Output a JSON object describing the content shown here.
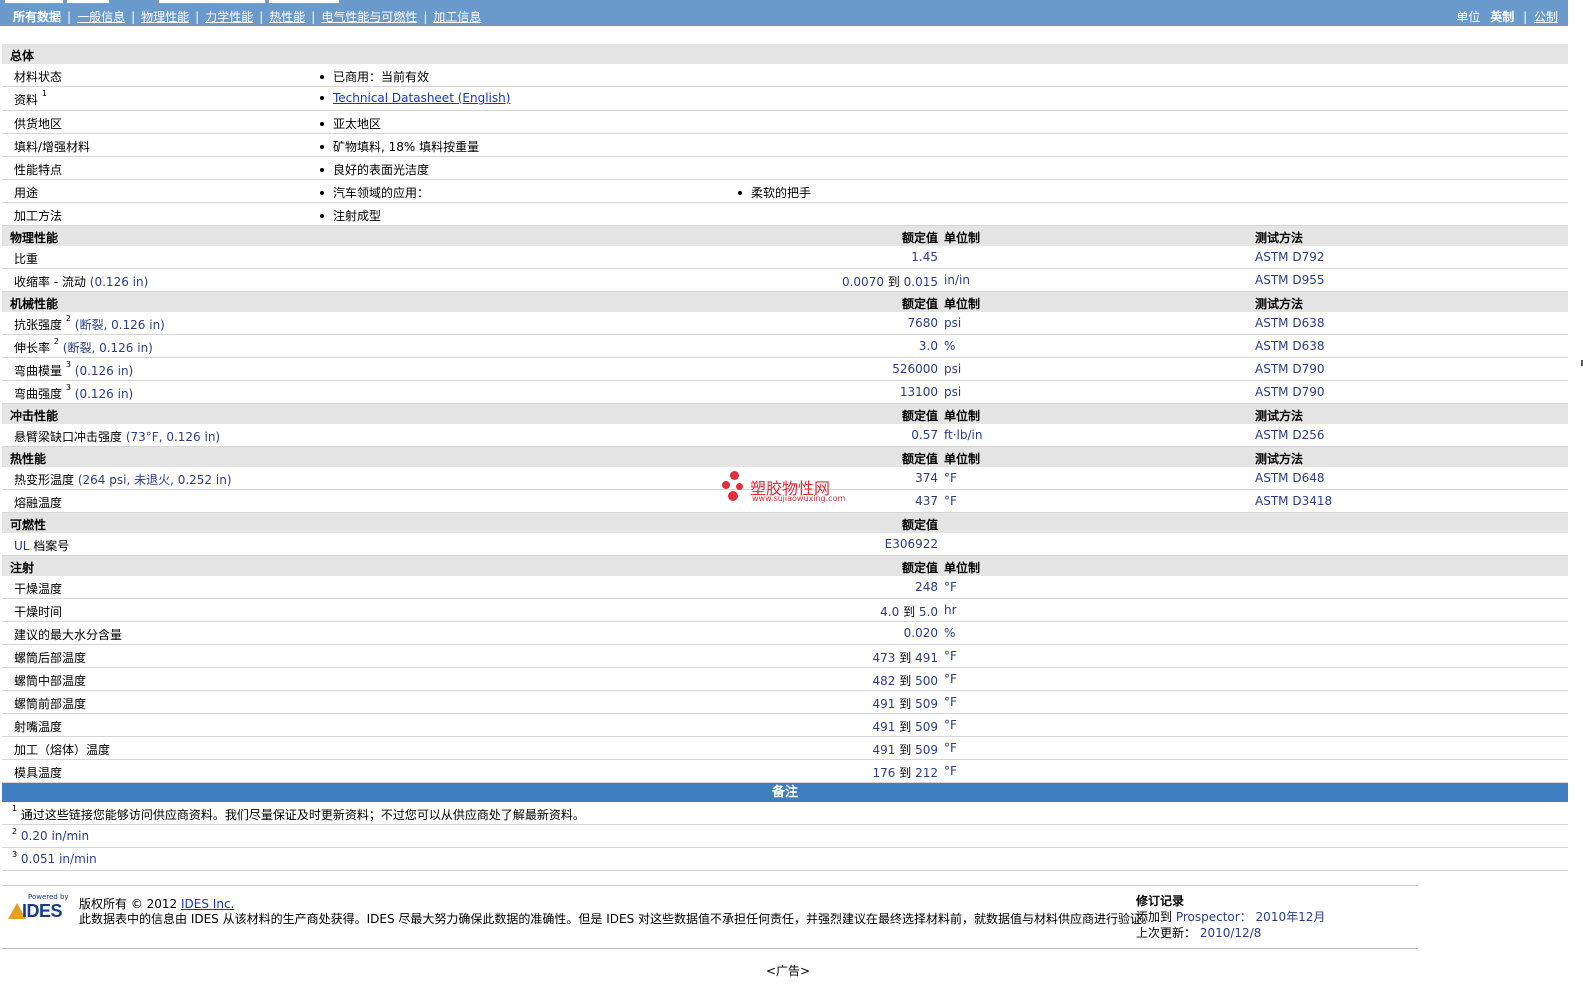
{
  "nav": {
    "items": [
      "所有数据",
      "一般信息",
      "物理性能",
      "力学性能",
      "热性能",
      "电气性能与可燃性",
      "加工信息"
    ],
    "unit_label": "单位",
    "unit_imperial": "英制",
    "unit_metric": "公制"
  },
  "general": {
    "title": "总体",
    "rows": [
      {
        "label": "材料状态",
        "items": [
          "已商用：当前有效"
        ]
      },
      {
        "label": "资料",
        "sup": "1",
        "items": [
          "Technical Datasheet (English)"
        ],
        "link": true
      },
      {
        "label": "供货地区",
        "items": [
          "亚太地区"
        ]
      },
      {
        "label": "填料/增强材料",
        "items": [
          "矿物填料, 18% 填料按重量"
        ]
      },
      {
        "label": "性能特点",
        "items": [
          "良好的表面光洁度"
        ]
      },
      {
        "label": "用途",
        "items": [
          "汽车领域的应用：",
          "柔软的把手"
        ]
      },
      {
        "label": "加工方法",
        "items": [
          "注射成型"
        ]
      }
    ]
  },
  "col_headers": {
    "value": "额定值",
    "unit": "单位制",
    "test": "测试方法"
  },
  "physical": {
    "title": "物理性能",
    "rows": [
      {
        "label": "比重",
        "extra": "",
        "value": "1.45",
        "unit": "",
        "test": "ASTM D792"
      },
      {
        "label": "收缩率 - 流动",
        "extra": "(0.126 in)",
        "v1": "0.0070",
        "v2": "0.015",
        "unit": "in/in",
        "test": "ASTM D955"
      }
    ]
  },
  "mechanical": {
    "title": "机械性能",
    "rows": [
      {
        "label": "抗张强度",
        "sup": "2",
        "extra": "(断裂, 0.126 in)",
        "value": "7680",
        "unit": "psi",
        "test": "ASTM D638"
      },
      {
        "label": "伸长率",
        "sup": "2",
        "extra": "(断裂, 0.126 in)",
        "value": "3.0",
        "unit": "%",
        "test": "ASTM D638"
      },
      {
        "label": "弯曲模量",
        "sup": "3",
        "extra": "(0.126 in)",
        "value": "526000",
        "unit": "psi",
        "test": "ASTM D790"
      },
      {
        "label": "弯曲强度",
        "sup": "3",
        "extra": "(0.126 in)",
        "value": "13100",
        "unit": "psi",
        "test": "ASTM D790"
      }
    ]
  },
  "impact": {
    "title": "冲击性能",
    "rows": [
      {
        "label": "悬臂梁缺口冲击强度",
        "extra": "(73°F, 0.126 in)",
        "value": "0.57",
        "unit": "ft·lb/in",
        "test": "ASTM D256"
      }
    ]
  },
  "thermal": {
    "title": "热性能",
    "rows": [
      {
        "label": "热变形温度",
        "extra": "(264 psi, 未退火, 0.252 in)",
        "value": "374",
        "unit": "°F",
        "test": "ASTM D648"
      },
      {
        "label": "熔融温度",
        "extra": "",
        "value": "437",
        "unit": "°F",
        "test": "ASTM D3418"
      }
    ]
  },
  "flammability": {
    "title": "可燃性",
    "rows": [
      {
        "label_prefix": "UL",
        "label": "档案号",
        "value": "E306922"
      }
    ]
  },
  "injection": {
    "title": "注射",
    "rows": [
      {
        "label": "干燥温度",
        "value": "248",
        "unit": "°F"
      },
      {
        "label": "干燥时间",
        "v1": "4.0",
        "v2": "5.0",
        "unit": "hr"
      },
      {
        "label": "建议的最大水分含量",
        "value": "0.020",
        "unit": "%"
      },
      {
        "label": "螺筒后部温度",
        "v1": "473",
        "v2": "491",
        "unit": "°F"
      },
      {
        "label": "螺筒中部温度",
        "v1": "482",
        "v2": "500",
        "unit": "°F"
      },
      {
        "label": "螺筒前部温度",
        "v1": "491",
        "v2": "509",
        "unit": "°F"
      },
      {
        "label": "射嘴温度",
        "v1": "491",
        "v2": "509",
        "unit": "°F"
      },
      {
        "label": "加工（熔体）温度",
        "v1": "491",
        "v2": "509",
        "unit": "°F"
      },
      {
        "label": "模具温度",
        "v1": "176",
        "v2": "212",
        "unit": "°F"
      }
    ]
  },
  "range_word": "到",
  "notes": {
    "title": "备注",
    "items": [
      {
        "sup": "1",
        "text": "通过这些链接您能够访问供应商资料。我们尽量保证及时更新资料；不过您可以从供应商处了解最新资料。",
        "blue": false
      },
      {
        "sup": "2",
        "text": "0.20 in/min",
        "blue": true
      },
      {
        "sup": "3",
        "text": "0.051 in/min",
        "blue": true
      }
    ]
  },
  "watermark": {
    "text": "塑胶物性网",
    "url": "www.sujiaowuxing.com"
  },
  "footer": {
    "logo_small": "Powered by",
    "logo_big": "IDES",
    "copyright_prefix": "版权所有 © 2012",
    "copyright_link": "IDES Inc.",
    "disclaimer": "此数据表中的信息由 IDES 从该材料的生产商处获得。IDES 尽最大努力确保此数据的准确性。但是 IDES 对这些数据值不承担任何责任，并强烈建议在最终选择材料前，就数据值与材料供应商进行验证。",
    "rev_title": "修订记录",
    "added_label": "添加到",
    "added_prefix": "Prospector：",
    "added_date": "2010年12月",
    "updated_label": "上次更新：",
    "updated_date": "2010/12/8",
    "ad": "<广告>"
  }
}
